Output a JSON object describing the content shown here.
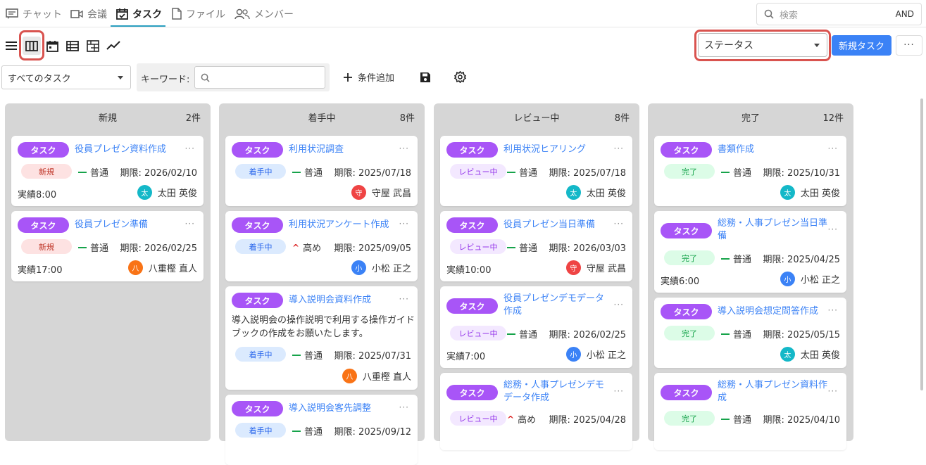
{
  "nav": {
    "tabs": [
      {
        "label": "チャット"
      },
      {
        "label": "会議"
      },
      {
        "label": "タスク"
      },
      {
        "label": "ファイル"
      },
      {
        "label": "メンバー"
      }
    ],
    "search_placeholder": "検索",
    "search_mode": "AND"
  },
  "toolbar": {
    "group_by": "ステータス",
    "new_task": "新規タスク",
    "more": "···"
  },
  "filters": {
    "scope": "すべてのタスク",
    "keyword_label": "キーワード:",
    "add_condition": "条件追加"
  },
  "columns": [
    {
      "title": "新規",
      "count": "2件",
      "cards": [
        {
          "badge": "タスク",
          "title": "役員プレゼン資料作成",
          "status": "新規",
          "priority": "普通",
          "due": "期限: 2026/02/10",
          "actual": "実績8:00",
          "avatar": "太",
          "assignee": "太田 英俊",
          "color": "#14b8c8"
        },
        {
          "badge": "タスク",
          "title": "役員プレゼン準備",
          "status": "新規",
          "priority": "普通",
          "due": "期限: 2026/02/25",
          "actual": "実績17:00",
          "avatar": "八",
          "assignee": "八重樫 直人",
          "color": "#f97316"
        }
      ]
    },
    {
      "title": "着手中",
      "count": "8件",
      "cards": [
        {
          "badge": "タスク",
          "title": "利用状況調査",
          "status": "着手中",
          "priority": "普通",
          "due": "期限: 2025/07/18",
          "actual": "",
          "avatar": "守",
          "assignee": "守屋 武昌",
          "color": "#ef4444"
        },
        {
          "badge": "タスク",
          "title": "利用状況アンケート作成",
          "status": "着手中",
          "priority": "高め",
          "due": "期限: 2025/09/05",
          "actual": "",
          "avatar": "小",
          "assignee": "小松 正之",
          "color": "#3b82f6"
        },
        {
          "badge": "タスク",
          "title": "導入説明会資料作成",
          "desc": "導入説明会の操作説明で利用する操作ガイドブックの作成をお願いたします。",
          "status": "着手中",
          "priority": "普通",
          "due": "期限: 2025/07/31",
          "actual": "",
          "avatar": "八",
          "assignee": "八重樫 直人",
          "color": "#f97316"
        },
        {
          "badge": "タスク",
          "title": "導入説明会客先調整",
          "status": "着手中",
          "priority": "普通",
          "due": "期限: 2025/09/12",
          "actual": "",
          "avatar": "",
          "assignee": "",
          "color": "#3b82f6"
        }
      ]
    },
    {
      "title": "レビュー中",
      "count": "8件",
      "cards": [
        {
          "badge": "タスク",
          "title": "利用状況ヒアリング",
          "status": "レビュー中",
          "priority": "普通",
          "due": "期限: 2025/07/18",
          "actual": "",
          "avatar": "太",
          "assignee": "太田 英俊",
          "color": "#14b8c8"
        },
        {
          "badge": "タスク",
          "title": "役員プレゼン当日準備",
          "status": "レビュー中",
          "priority": "普通",
          "due": "期限: 2026/03/03",
          "actual": "実績10:00",
          "avatar": "守",
          "assignee": "守屋 武昌",
          "color": "#ef4444"
        },
        {
          "badge": "タスク",
          "title": "役員プレゼンデモデータ作成",
          "status": "レビュー中",
          "priority": "普通",
          "due": "期限: 2026/02/25",
          "actual": "実績7:00",
          "avatar": "小",
          "assignee": "小松 正之",
          "color": "#3b82f6"
        },
        {
          "badge": "タスク",
          "title": "総務・人事プレゼンデモデータ作成",
          "status": "レビュー中",
          "priority": "高め",
          "due": "期限: 2025/04/28",
          "actual": "",
          "avatar": "",
          "assignee": "",
          "color": "#3b82f6"
        }
      ]
    },
    {
      "title": "完了",
      "count": "12件",
      "cards": [
        {
          "badge": "タスク",
          "title": "書類作成",
          "status": "完了",
          "priority": "普通",
          "due": "期限: 2025/10/31",
          "actual": "",
          "avatar": "太",
          "assignee": "太田 英俊",
          "color": "#14b8c8"
        },
        {
          "badge": "タスク",
          "title": "総務・人事プレゼン当日準備",
          "status": "完了",
          "priority": "普通",
          "due": "期限: 2025/04/25",
          "actual": "実績6:00",
          "avatar": "小",
          "assignee": "小松 正之",
          "color": "#3b82f6"
        },
        {
          "badge": "タスク",
          "title": "導入説明会想定問答作成",
          "status": "完了",
          "priority": "普通",
          "due": "期限: 2025/05/15",
          "actual": "",
          "avatar": "太",
          "assignee": "太田 英俊",
          "color": "#14b8c8"
        },
        {
          "badge": "タスク",
          "title": "総務・人事プレゼン資料作成",
          "status": "完了",
          "priority": "普通",
          "due": "期限: 2025/04/10",
          "actual": "",
          "avatar": "",
          "assignee": "",
          "color": "#14b8c8"
        }
      ]
    }
  ]
}
